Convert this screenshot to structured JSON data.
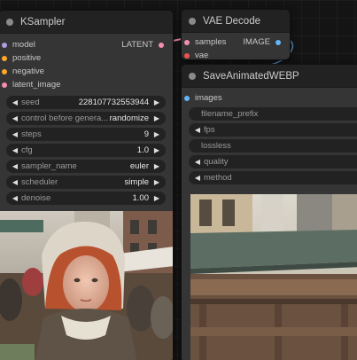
{
  "ksampler": {
    "title": "KSampler",
    "inputs": [
      {
        "label": "model",
        "color": "#b39ddb"
      },
      {
        "label": "positive",
        "color": "#ffa726"
      },
      {
        "label": "negative",
        "color": "#ffa726"
      },
      {
        "label": "latent_image",
        "color": "#f48fb1"
      }
    ],
    "output": {
      "label": "LATENT",
      "color": "#f48fb1"
    },
    "widgets": [
      {
        "label": "seed",
        "value": "228107732553944"
      },
      {
        "label": "control before genera...",
        "value": "randomize"
      },
      {
        "label": "steps",
        "value": "9"
      },
      {
        "label": "cfg",
        "value": "1.0"
      },
      {
        "label": "sampler_name",
        "value": "euler"
      },
      {
        "label": "scheduler",
        "value": "simple"
      },
      {
        "label": "denoise",
        "value": "1.00"
      }
    ]
  },
  "vae_decode": {
    "title": "VAE Decode",
    "inputs": [
      {
        "label": "samples",
        "color": "#f48fb1"
      },
      {
        "label": "vae",
        "color": "#ef5350"
      }
    ],
    "output": {
      "label": "IMAGE",
      "color": "#64b5f6"
    }
  },
  "save_webp": {
    "title": "SaveAnimatedWEBP",
    "inputs": [
      {
        "label": "images",
        "color": "#64b5f6"
      }
    ],
    "widgets": [
      {
        "label": "filename_prefix"
      },
      {
        "label": "fps"
      },
      {
        "label": "lossless"
      },
      {
        "label": "quality"
      },
      {
        "label": "method"
      }
    ]
  },
  "icons": {
    "left_arrow": "◀",
    "right_arrow": "▶"
  }
}
